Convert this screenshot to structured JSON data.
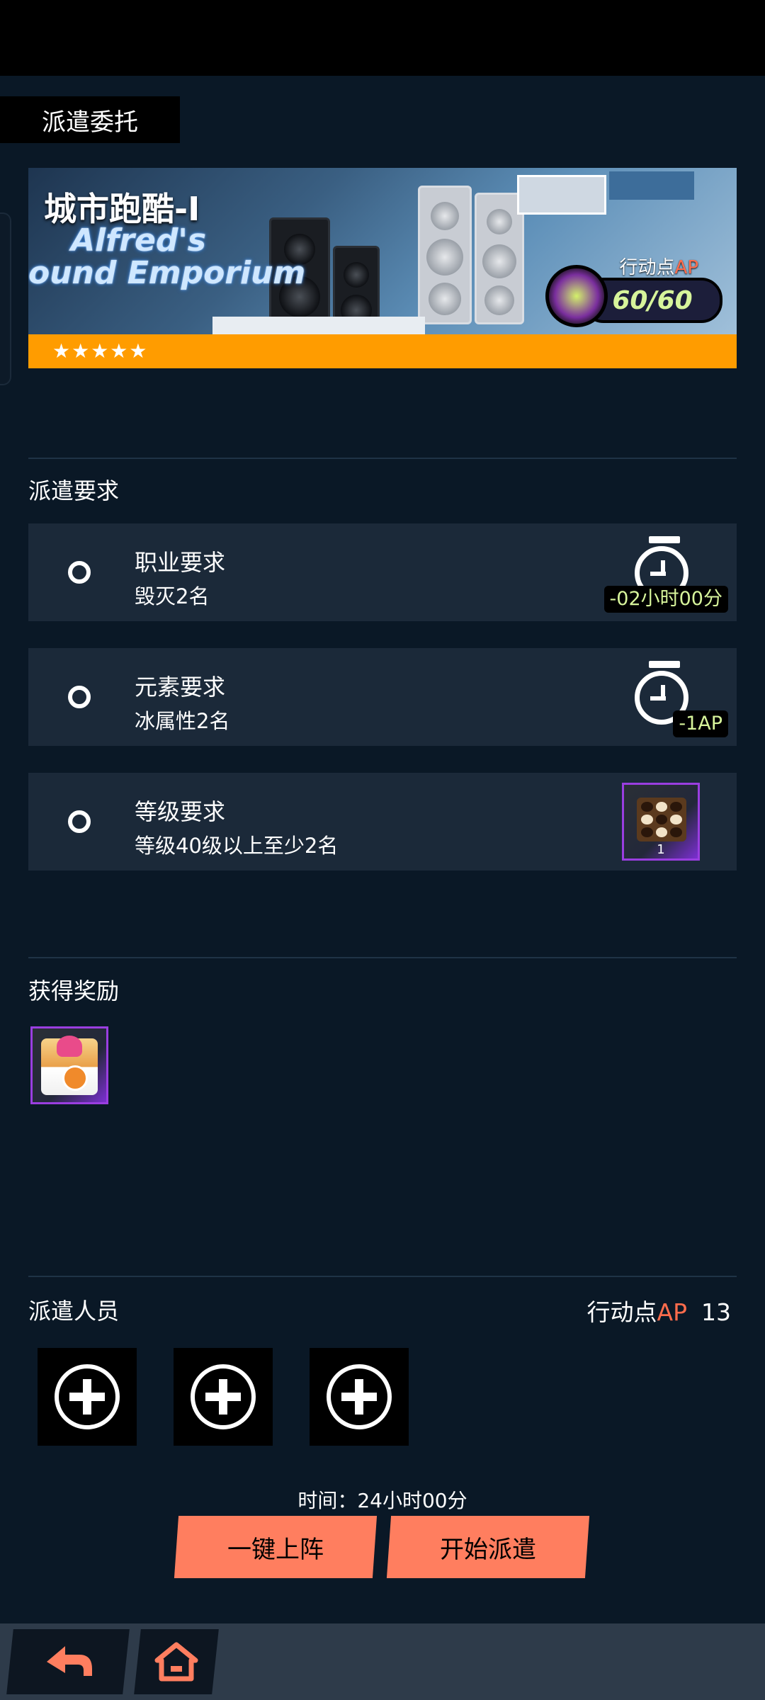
{
  "header": {
    "title": "派遣委托"
  },
  "banner": {
    "mission_name": "城市跑酷-I",
    "store_sign_line1": "Alfred's",
    "store_sign_line2": "ound Emporium",
    "stars": "★★★★★",
    "ap_label_prefix": "行动点",
    "ap_label_suffix": "AP",
    "ap_value": "60/60"
  },
  "requirements": {
    "title": "派遣要求",
    "items": [
      {
        "title": "职业要求",
        "detail": "毁灭2名",
        "reward_badge": "-02小时00分",
        "reward_icon": "stopwatch-icon"
      },
      {
        "title": "元素要求",
        "detail": "冰属性2名",
        "reward_badge": "-1AP",
        "reward_icon": "stopwatch-icon"
      },
      {
        "title": "等级要求",
        "detail": "等级40级以上至少2名",
        "reward_count": "1",
        "reward_icon": "chocolate-box-icon"
      }
    ]
  },
  "rewards": {
    "title": "获得奖励",
    "items": [
      {
        "icon": "gift-crate-icon"
      }
    ]
  },
  "dispatch": {
    "title": "派遣人员",
    "ap_prefix": "行动点",
    "ap_suffix": "AP",
    "ap_value": "13",
    "slots": 3,
    "time_text": "时间：24小时00分",
    "auto_button": "一键上阵",
    "start_button": "开始派遣"
  },
  "nav": {
    "back_icon": "back-arrow-icon",
    "home_icon": "home-icon"
  },
  "colors": {
    "accent": "#ff7e5f",
    "ap_red": "#ff6c4c",
    "stripe": "#ff9c00",
    "badge_green": "#d7f49b",
    "rare_purple": "#9a3ee0"
  }
}
